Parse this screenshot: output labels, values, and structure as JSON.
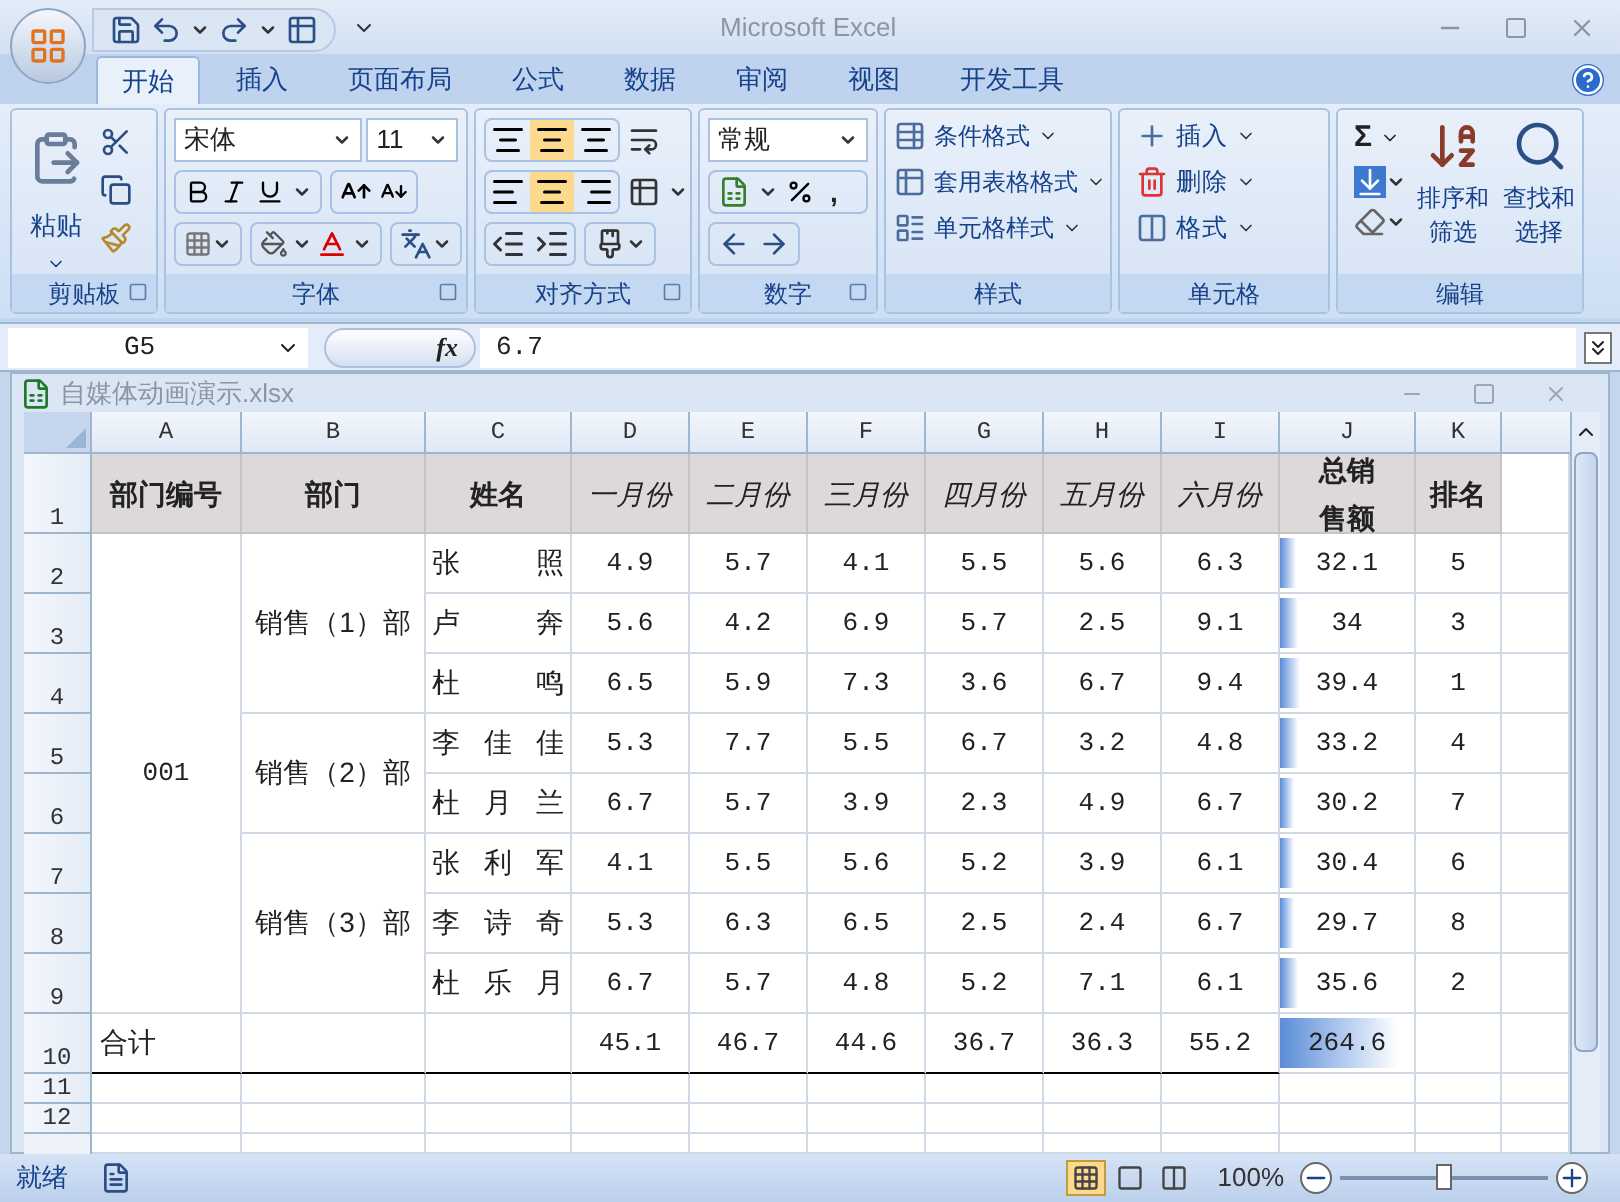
{
  "window": {
    "title": "Microsoft Excel"
  },
  "tabs": [
    {
      "label": "开始",
      "selected": true
    },
    {
      "label": "插入",
      "selected": false
    },
    {
      "label": "页面布局",
      "selected": false
    },
    {
      "label": "公式",
      "selected": false
    },
    {
      "label": "数据",
      "selected": false
    },
    {
      "label": "审阅",
      "selected": false
    },
    {
      "label": "视图",
      "selected": false
    },
    {
      "label": "开发工具",
      "selected": false
    }
  ],
  "ribbon": {
    "clipboard": {
      "paste": "粘贴",
      "label": "剪贴板"
    },
    "font": {
      "name": "宋体",
      "size": "11",
      "label": "字体"
    },
    "alignment": {
      "label": "对齐方式"
    },
    "number": {
      "format": "常规",
      "comma": ",",
      "label": "数字"
    },
    "styles": {
      "items": [
        "条件格式",
        "套用表格格式",
        "单元格样式"
      ],
      "label": "样式"
    },
    "cells": {
      "items": [
        "插入",
        "删除",
        "格式"
      ],
      "label": "单元格"
    },
    "editing": {
      "sigma": "Σ",
      "sort": "排序和筛选",
      "find": "查找和选择",
      "label": "编辑"
    }
  },
  "formula_bar": {
    "name_box": "G5",
    "function_label": "fx",
    "value": "6.7"
  },
  "workbook": {
    "title": "自媒体动画演示.xlsx"
  },
  "sheet": {
    "columns": [
      "A",
      "B",
      "C",
      "D",
      "E",
      "F",
      "G",
      "H",
      "I",
      "J",
      "K"
    ],
    "row_numbers": [
      "1",
      "2",
      "3",
      "4",
      "5",
      "6",
      "7",
      "8",
      "9",
      "10",
      "11",
      "12"
    ],
    "header": [
      "部门编号",
      "部门",
      "姓名",
      "一月份",
      "二月份",
      "三月份",
      "四月份",
      "五月份",
      "六月份",
      "总销售额",
      "排名"
    ],
    "departments": [
      {
        "code": "001",
        "name": "销售（1）部",
        "people": [
          {
            "name": "张照",
            "months": [
              "4.9",
              "5.7",
              "4.1",
              "5.5",
              "5.6",
              "6.3"
            ],
            "total": "32.1",
            "level": 0.12,
            "rank": "5"
          },
          {
            "name": "卢奔",
            "months": [
              "5.6",
              "4.2",
              "6.9",
              "5.7",
              "2.5",
              "9.1"
            ],
            "total": "34",
            "level": 0.13,
            "rank": "3"
          },
          {
            "name": "杜鸣",
            "months": [
              "6.5",
              "5.9",
              "7.3",
              "3.6",
              "6.7",
              "9.4"
            ],
            "total": "39.4",
            "level": 0.15,
            "rank": "1"
          }
        ]
      },
      {
        "name": "销售（2）部",
        "people": [
          {
            "name": "李佳佳",
            "months": [
              "5.3",
              "7.7",
              "5.5",
              "6.7",
              "3.2",
              "4.8"
            ],
            "total": "33.2",
            "level": 0.13,
            "rank": "4"
          },
          {
            "name": "杜月兰",
            "months": [
              "6.7",
              "5.7",
              "3.9",
              "2.3",
              "4.9",
              "6.7"
            ],
            "total": "30.2",
            "level": 0.11,
            "rank": "7"
          }
        ]
      },
      {
        "name": "销售（3）部",
        "people": [
          {
            "name": "张利军",
            "months": [
              "4.1",
              "5.5",
              "5.6",
              "5.2",
              "3.9",
              "6.1"
            ],
            "total": "30.4",
            "level": 0.11,
            "rank": "6"
          },
          {
            "name": "李诗奇",
            "months": [
              "5.3",
              "6.3",
              "6.5",
              "2.5",
              "2.4",
              "6.7"
            ],
            "total": "29.7",
            "level": 0.11,
            "rank": "8"
          },
          {
            "name": "杜乐月",
            "months": [
              "6.7",
              "5.7",
              "4.8",
              "5.2",
              "7.1",
              "6.1"
            ],
            "total": "35.6",
            "level": 0.13,
            "rank": "2"
          }
        ]
      }
    ],
    "total_row": {
      "label": "合计",
      "months": [
        "45.1",
        "46.7",
        "44.6",
        "36.7",
        "36.3",
        "55.2"
      ],
      "total": "264.6",
      "level": 0.88
    }
  },
  "status_bar": {
    "status": "就绪",
    "views": [
      {
        "selected": true
      },
      {
        "selected": false
      },
      {
        "selected": false
      }
    ],
    "zoom": "100%",
    "zoom_slider": {
      "level": 0.5
    }
  }
}
